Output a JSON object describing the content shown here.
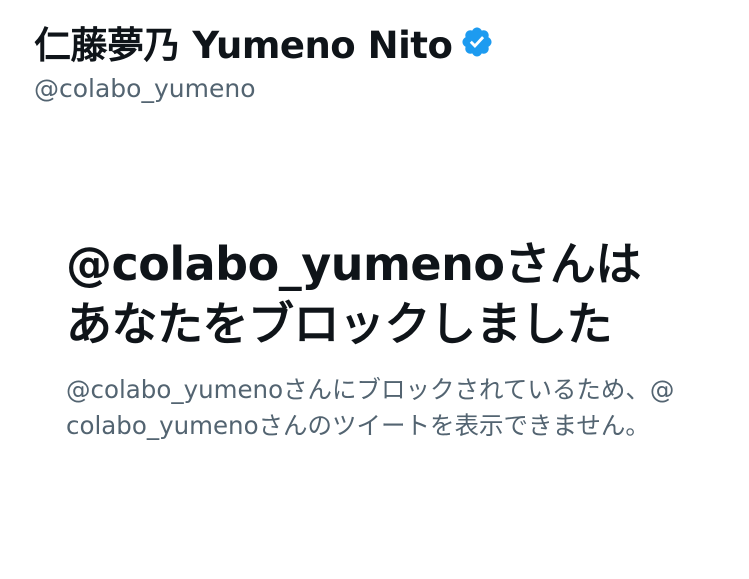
{
  "profile": {
    "display_name": "仁藤夢乃  Yumeno Nito",
    "handle": "@colabo_yumeno",
    "verified": true,
    "verified_color": "#1d9bf0"
  },
  "blocked": {
    "title": "@colabo_yumenoさんはあなたをブロックしました",
    "description": "@colabo_yumenoさんにブロックされているため、@colabo_yumenoさんのツイートを表示できません。"
  }
}
